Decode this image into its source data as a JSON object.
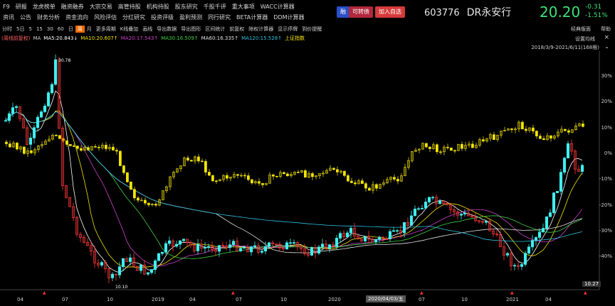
{
  "nav": {
    "row1": [
      "F9",
      "研报",
      "龙虎榜单",
      "融资融券",
      "大宗交易",
      "高管持股",
      "机构持股",
      "股东研究",
      "千股千评",
      "重大事项",
      "WACC计算器"
    ],
    "row2": [
      "资讯",
      "公告",
      "财务分析",
      "资金流向",
      "风险评估",
      "分红研究",
      "投资评级",
      "盈利预测",
      "同行研究",
      "BETA计算器",
      "DDM计算器"
    ]
  },
  "header": {
    "rong_label": "融",
    "kezhuanzhai_label": "可转债",
    "add_watch_label": "加入自选",
    "stock_code": "603776",
    "stock_name": "DR永安行",
    "price": "20.20",
    "change": "-0.31",
    "change_pct": "-1.51%"
  },
  "toolbar": {
    "items": [
      "分时",
      "5日",
      "5",
      "15",
      "30",
      "60",
      "日",
      "周",
      "月",
      "更多周期",
      "K线叠加",
      "画线",
      "导出数据",
      "导出图形",
      "区间统计",
      "前复权",
      "除权计算器",
      "显示停牌",
      "到价提醒"
    ],
    "active": "周",
    "classic_label": "经典版面",
    "help_label": "帮助"
  },
  "ma_legend": {
    "adj": "(周线前复权)",
    "ma": "MA",
    "ma5": "MA5:20.843↓",
    "ma10": "MA10:20.607↑",
    "ma20": "MA20:17.543↑",
    "ma30": "MA30:16.509↑",
    "ma60": "MA60:16.335↑",
    "ma120": "MA120:15.528↑",
    "index": "上证指数",
    "settings": "设置均线",
    "range": "2018/3/9-2021/6/11(168根)"
  },
  "chart_data": {
    "type": "candlestick",
    "high_label": "30.78",
    "low_label": "10.10",
    "last_label": "10.27",
    "crosshair_date": "2020/04/03/五",
    "y_ticks": [
      "30%",
      "20%",
      "10%",
      "0%",
      "-10%",
      "-20%",
      "-30%",
      "-40%"
    ],
    "x_ticks": [
      "04",
      "07",
      "10",
      "2019",
      "04",
      "07",
      "10",
      "2020",
      "04",
      "07",
      "10",
      "2021",
      "04"
    ],
    "colors": {
      "up": "#3ff0f0",
      "down": "#ff3838",
      "index": "#f4e400",
      "ma5": "#ffffff",
      "ma10": "#f4e400",
      "ma20": "#d040d0",
      "ma30": "#40d040",
      "ma60": "#e0e0e0",
      "ma120": "#30c0e0"
    }
  }
}
